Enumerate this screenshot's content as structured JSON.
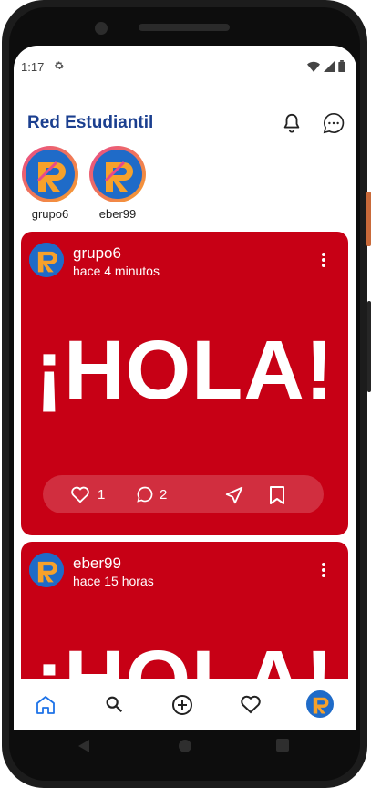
{
  "status_bar": {
    "time": "1:17",
    "settings_icon": "gear-icon",
    "wifi_icon": "wifi-icon",
    "signal_icon": "signal-icon",
    "battery_icon": "battery-icon"
  },
  "app_bar": {
    "title": "Red Estudiantil",
    "bell_icon": "bell-icon",
    "chat_icon": "chat-bubble-icon",
    "title_color": "#1b3f8f"
  },
  "stories": [
    {
      "username": "grupo6"
    },
    {
      "username": "eber99"
    }
  ],
  "posts": [
    {
      "username": "grupo6",
      "time_ago": "hace 4 minutos",
      "image_text": "¡HOLA!",
      "likes": "1",
      "comments": "2"
    },
    {
      "username": "eber99",
      "time_ago": "hace 15 horas",
      "image_text": "¡HOLA!"
    }
  ],
  "bottom_nav": {
    "items": [
      "home-icon",
      "search-icon",
      "add-circle-icon",
      "heart-icon",
      "profile-avatar"
    ],
    "active": "home-icon",
    "accent": "#1e73e8"
  },
  "colors": {
    "post_background": "#c70015",
    "avatar_gradient_start": "#e84a8a",
    "avatar_gradient_end": "#f6a12b"
  }
}
